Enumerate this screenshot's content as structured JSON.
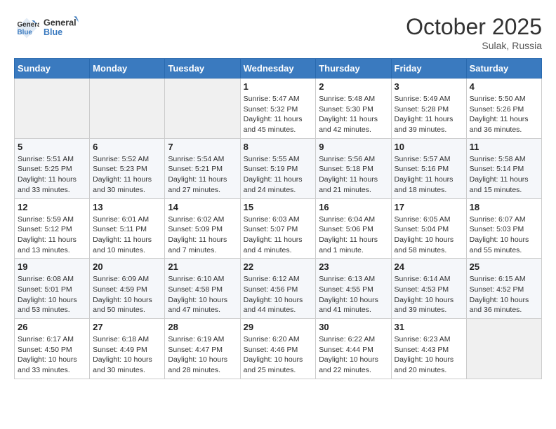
{
  "header": {
    "logo_line1": "General",
    "logo_line2": "Blue",
    "month": "October 2025",
    "location": "Sulak, Russia"
  },
  "weekdays": [
    "Sunday",
    "Monday",
    "Tuesday",
    "Wednesday",
    "Thursday",
    "Friday",
    "Saturday"
  ],
  "weeks": [
    [
      {
        "day": "",
        "info": ""
      },
      {
        "day": "",
        "info": ""
      },
      {
        "day": "",
        "info": ""
      },
      {
        "day": "1",
        "info": "Sunrise: 5:47 AM\nSunset: 5:32 PM\nDaylight: 11 hours\nand 45 minutes."
      },
      {
        "day": "2",
        "info": "Sunrise: 5:48 AM\nSunset: 5:30 PM\nDaylight: 11 hours\nand 42 minutes."
      },
      {
        "day": "3",
        "info": "Sunrise: 5:49 AM\nSunset: 5:28 PM\nDaylight: 11 hours\nand 39 minutes."
      },
      {
        "day": "4",
        "info": "Sunrise: 5:50 AM\nSunset: 5:26 PM\nDaylight: 11 hours\nand 36 minutes."
      }
    ],
    [
      {
        "day": "5",
        "info": "Sunrise: 5:51 AM\nSunset: 5:25 PM\nDaylight: 11 hours\nand 33 minutes."
      },
      {
        "day": "6",
        "info": "Sunrise: 5:52 AM\nSunset: 5:23 PM\nDaylight: 11 hours\nand 30 minutes."
      },
      {
        "day": "7",
        "info": "Sunrise: 5:54 AM\nSunset: 5:21 PM\nDaylight: 11 hours\nand 27 minutes."
      },
      {
        "day": "8",
        "info": "Sunrise: 5:55 AM\nSunset: 5:19 PM\nDaylight: 11 hours\nand 24 minutes."
      },
      {
        "day": "9",
        "info": "Sunrise: 5:56 AM\nSunset: 5:18 PM\nDaylight: 11 hours\nand 21 minutes."
      },
      {
        "day": "10",
        "info": "Sunrise: 5:57 AM\nSunset: 5:16 PM\nDaylight: 11 hours\nand 18 minutes."
      },
      {
        "day": "11",
        "info": "Sunrise: 5:58 AM\nSunset: 5:14 PM\nDaylight: 11 hours\nand 15 minutes."
      }
    ],
    [
      {
        "day": "12",
        "info": "Sunrise: 5:59 AM\nSunset: 5:12 PM\nDaylight: 11 hours\nand 13 minutes."
      },
      {
        "day": "13",
        "info": "Sunrise: 6:01 AM\nSunset: 5:11 PM\nDaylight: 11 hours\nand 10 minutes."
      },
      {
        "day": "14",
        "info": "Sunrise: 6:02 AM\nSunset: 5:09 PM\nDaylight: 11 hours\nand 7 minutes."
      },
      {
        "day": "15",
        "info": "Sunrise: 6:03 AM\nSunset: 5:07 PM\nDaylight: 11 hours\nand 4 minutes."
      },
      {
        "day": "16",
        "info": "Sunrise: 6:04 AM\nSunset: 5:06 PM\nDaylight: 11 hours\nand 1 minute."
      },
      {
        "day": "17",
        "info": "Sunrise: 6:05 AM\nSunset: 5:04 PM\nDaylight: 10 hours\nand 58 minutes."
      },
      {
        "day": "18",
        "info": "Sunrise: 6:07 AM\nSunset: 5:03 PM\nDaylight: 10 hours\nand 55 minutes."
      }
    ],
    [
      {
        "day": "19",
        "info": "Sunrise: 6:08 AM\nSunset: 5:01 PM\nDaylight: 10 hours\nand 53 minutes."
      },
      {
        "day": "20",
        "info": "Sunrise: 6:09 AM\nSunset: 4:59 PM\nDaylight: 10 hours\nand 50 minutes."
      },
      {
        "day": "21",
        "info": "Sunrise: 6:10 AM\nSunset: 4:58 PM\nDaylight: 10 hours\nand 47 minutes."
      },
      {
        "day": "22",
        "info": "Sunrise: 6:12 AM\nSunset: 4:56 PM\nDaylight: 10 hours\nand 44 minutes."
      },
      {
        "day": "23",
        "info": "Sunrise: 6:13 AM\nSunset: 4:55 PM\nDaylight: 10 hours\nand 41 minutes."
      },
      {
        "day": "24",
        "info": "Sunrise: 6:14 AM\nSunset: 4:53 PM\nDaylight: 10 hours\nand 39 minutes."
      },
      {
        "day": "25",
        "info": "Sunrise: 6:15 AM\nSunset: 4:52 PM\nDaylight: 10 hours\nand 36 minutes."
      }
    ],
    [
      {
        "day": "26",
        "info": "Sunrise: 6:17 AM\nSunset: 4:50 PM\nDaylight: 10 hours\nand 33 minutes."
      },
      {
        "day": "27",
        "info": "Sunrise: 6:18 AM\nSunset: 4:49 PM\nDaylight: 10 hours\nand 30 minutes."
      },
      {
        "day": "28",
        "info": "Sunrise: 6:19 AM\nSunset: 4:47 PM\nDaylight: 10 hours\nand 28 minutes."
      },
      {
        "day": "29",
        "info": "Sunrise: 6:20 AM\nSunset: 4:46 PM\nDaylight: 10 hours\nand 25 minutes."
      },
      {
        "day": "30",
        "info": "Sunrise: 6:22 AM\nSunset: 4:44 PM\nDaylight: 10 hours\nand 22 minutes."
      },
      {
        "day": "31",
        "info": "Sunrise: 6:23 AM\nSunset: 4:43 PM\nDaylight: 10 hours\nand 20 minutes."
      },
      {
        "day": "",
        "info": ""
      }
    ]
  ]
}
